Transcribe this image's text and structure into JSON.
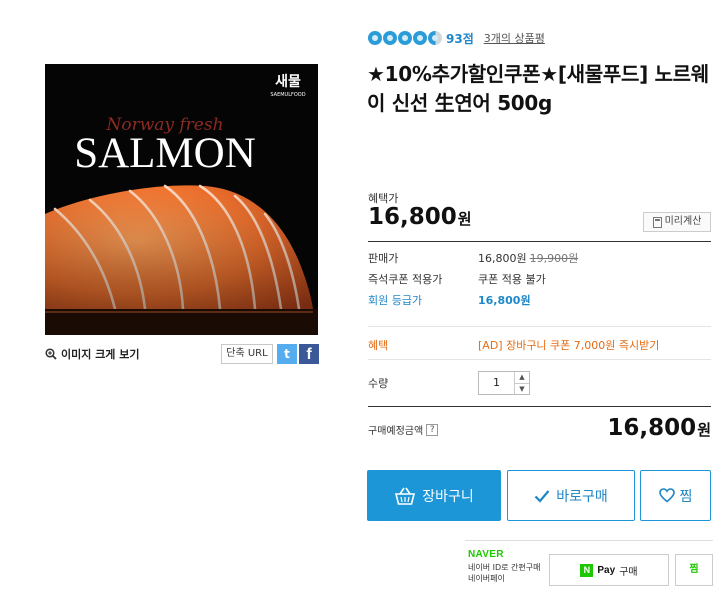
{
  "product_image": {
    "brand_korean": "새물",
    "brand_english": "SAEMULFOOD",
    "script_text": "Norway fresh",
    "headline": "SALMON"
  },
  "image_tools": {
    "zoom_label": "이미지 크게 보기",
    "short_url_label": "단축 URL",
    "twitter_icon": "t",
    "facebook_icon": "f"
  },
  "rating": {
    "stars_filled": 4.5,
    "score": "93점",
    "review_link": "3개의 상품평"
  },
  "product": {
    "title": "★10%추가할인쿠폰★[새물푸드] 노르웨이 신선 生연어 500g"
  },
  "benefit_price": {
    "label": "혜택가",
    "amount": "16,800",
    "unit": "원",
    "calc_button": "미리계산"
  },
  "price_info": {
    "sale_label": "판매가",
    "sale_price": "16,800원",
    "original_price": "19,900원",
    "coupon_label": "즉석쿠폰 적용가",
    "coupon_value": "쿠폰 적용 불가",
    "member_label": "회원 등급가",
    "member_price": "16,800원"
  },
  "benefit": {
    "label": "혜택",
    "text": "[AD] 장바구니 쿠폰 7,000원 즉시받기"
  },
  "quantity": {
    "label": "수량",
    "value": "1",
    "up": "▲",
    "down": "▼"
  },
  "total": {
    "label": "구매예정금액",
    "help": "?",
    "amount": "16,800",
    "unit": "원"
  },
  "buttons": {
    "cart": "장바구니",
    "buy_now": "바로구매",
    "wish": "찜"
  },
  "naver": {
    "logo": "NAVER",
    "desc": "네이버 ID로 간편구매 네이버페이",
    "npay_n": "N",
    "npay_pay": "Pay",
    "npay_buy": "구매",
    "wish": "찜"
  },
  "colors": {
    "accent_blue": "#1d96d8",
    "price_blue": "#1e87c9",
    "benefit_orange": "#e56b12",
    "naver_green": "#1ec800",
    "salmon": "#f07a3c"
  }
}
